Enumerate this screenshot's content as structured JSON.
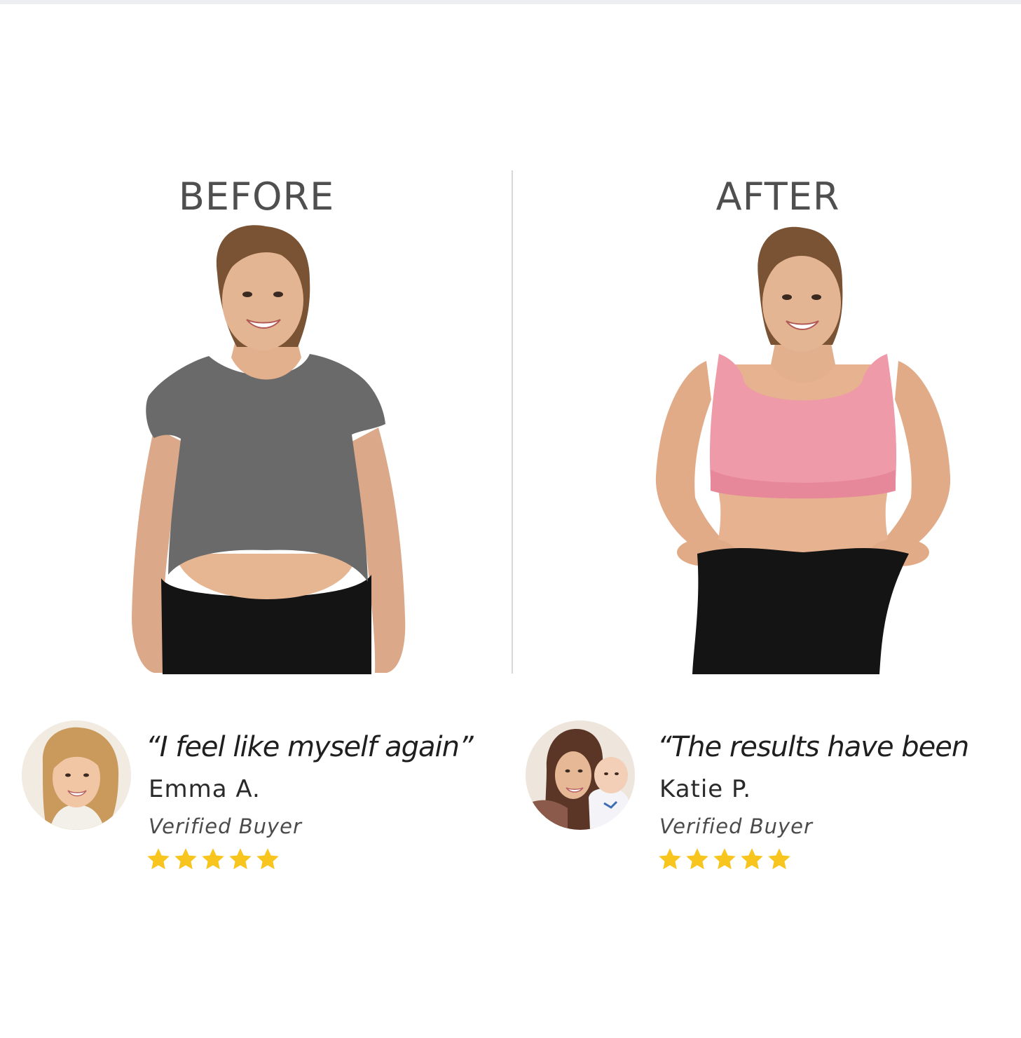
{
  "headings": {
    "before": "BEFORE",
    "after": "AFTER"
  },
  "reviews": [
    {
      "quote": "“I feel like myself again”",
      "name": "Emma A.",
      "badge": "Verified Buyer",
      "rating": 5
    },
    {
      "quote": "“The results have been",
      "name": "Katie P.",
      "badge": "Verified Buyer",
      "rating": 5
    }
  ],
  "colors": {
    "star": "#f7c51e",
    "heading": "#4f4f4f",
    "before_shirt": "#6a6a6b",
    "after_top": "#ef9aa8",
    "leggings": "#141414",
    "skin": "#e2b08d",
    "hair": "#7a5234"
  }
}
